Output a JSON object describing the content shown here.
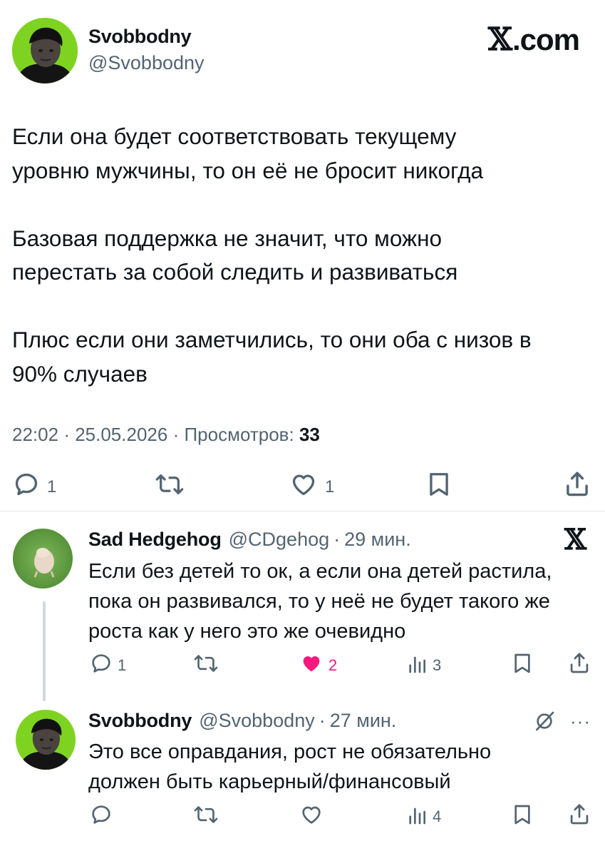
{
  "colors": {
    "accent_like": "#f91880",
    "text": "#0f1419",
    "secondary": "#536471",
    "avatar_green": "#7ed321"
  },
  "main": {
    "author_name": "Svobbodny",
    "author_handle": "@Svobbodny",
    "brand": ".com",
    "paragraphs": [
      [
        "Если она будет соответствовать текущему",
        "уровню мужчины, то он её не бросит никогда"
      ],
      [
        "Базовая поддержка не значит, что можно",
        "перестать за собой следить и развиваться"
      ],
      [
        "Плюс если они заметчились, то они оба с низов в",
        "90% случаев"
      ]
    ],
    "time": "22:02",
    "date": "25.05.2026",
    "views_label": "Просмотров:",
    "views_count": "33",
    "actions": {
      "reply_count": "1",
      "retweet_count": "",
      "like_count": "1"
    },
    "icons": [
      "reply-icon",
      "retweet-icon",
      "like-icon",
      "bookmark-icon",
      "share-icon"
    ]
  },
  "replies": [
    {
      "author_name": "Sad Hedgehog",
      "author_handle": "@CDgehog",
      "separator": "·",
      "time": "29 мин.",
      "lines": [
        "Если без детей то ок, а если она детей растила,",
        "пока он развивался, то у неё не будет такого же",
        "роста как у него это же очевидно"
      ],
      "reply_count": "1",
      "like_count": "2",
      "views_count": "3",
      "liked": true,
      "badge_icon": "x-logo-icon"
    },
    {
      "author_name": "Svobbodny",
      "author_handle": "@Svobbodny",
      "separator": "·",
      "time": "27 мин.",
      "lines": [
        "Это все оправдания, рост не обязательно",
        "должен быть карьерный/финансовый"
      ],
      "reply_count": "",
      "like_count": "",
      "views_count": "4",
      "liked": false,
      "badge_icon": "grok-icon",
      "more_icon": "more-icon"
    }
  ]
}
